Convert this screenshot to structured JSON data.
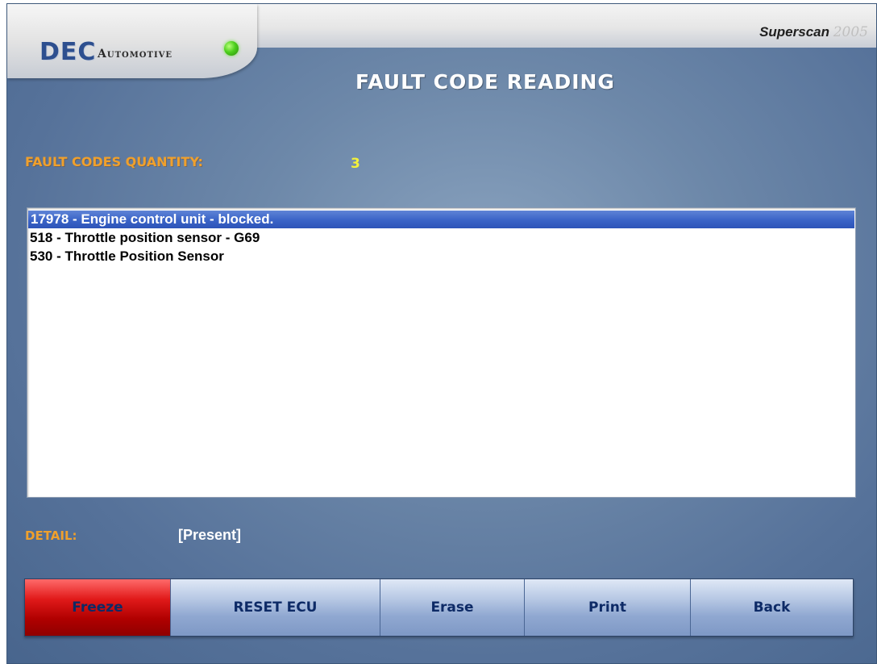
{
  "header": {
    "brand_logo": "DEC",
    "brand_sub": "Automotive",
    "status_led_color": "#4ccf1c",
    "product_name": "Superscan",
    "product_year": "2005"
  },
  "title": "FAULT CODE READING",
  "fault_codes": {
    "quantity_label": "FAULT CODES QUANTITY:",
    "quantity_value": "3",
    "items": [
      "17978 - Engine control unit - blocked.",
      "518 - Throttle position sensor - G69",
      "530 - Throttle Position Sensor"
    ],
    "selected_index": 0
  },
  "detail": {
    "label": "DETAIL:",
    "value": "[Present]"
  },
  "toolbar": {
    "freeze": "Freeze",
    "reset_ecu": "RESET ECU",
    "erase": "Erase",
    "print": "Print",
    "back": "Back"
  },
  "colors": {
    "accent_orange": "#f0a02c",
    "quantity_yellow": "#f4f23a",
    "selection_blue": "#3a63c7",
    "active_red": "#e11a1a"
  }
}
